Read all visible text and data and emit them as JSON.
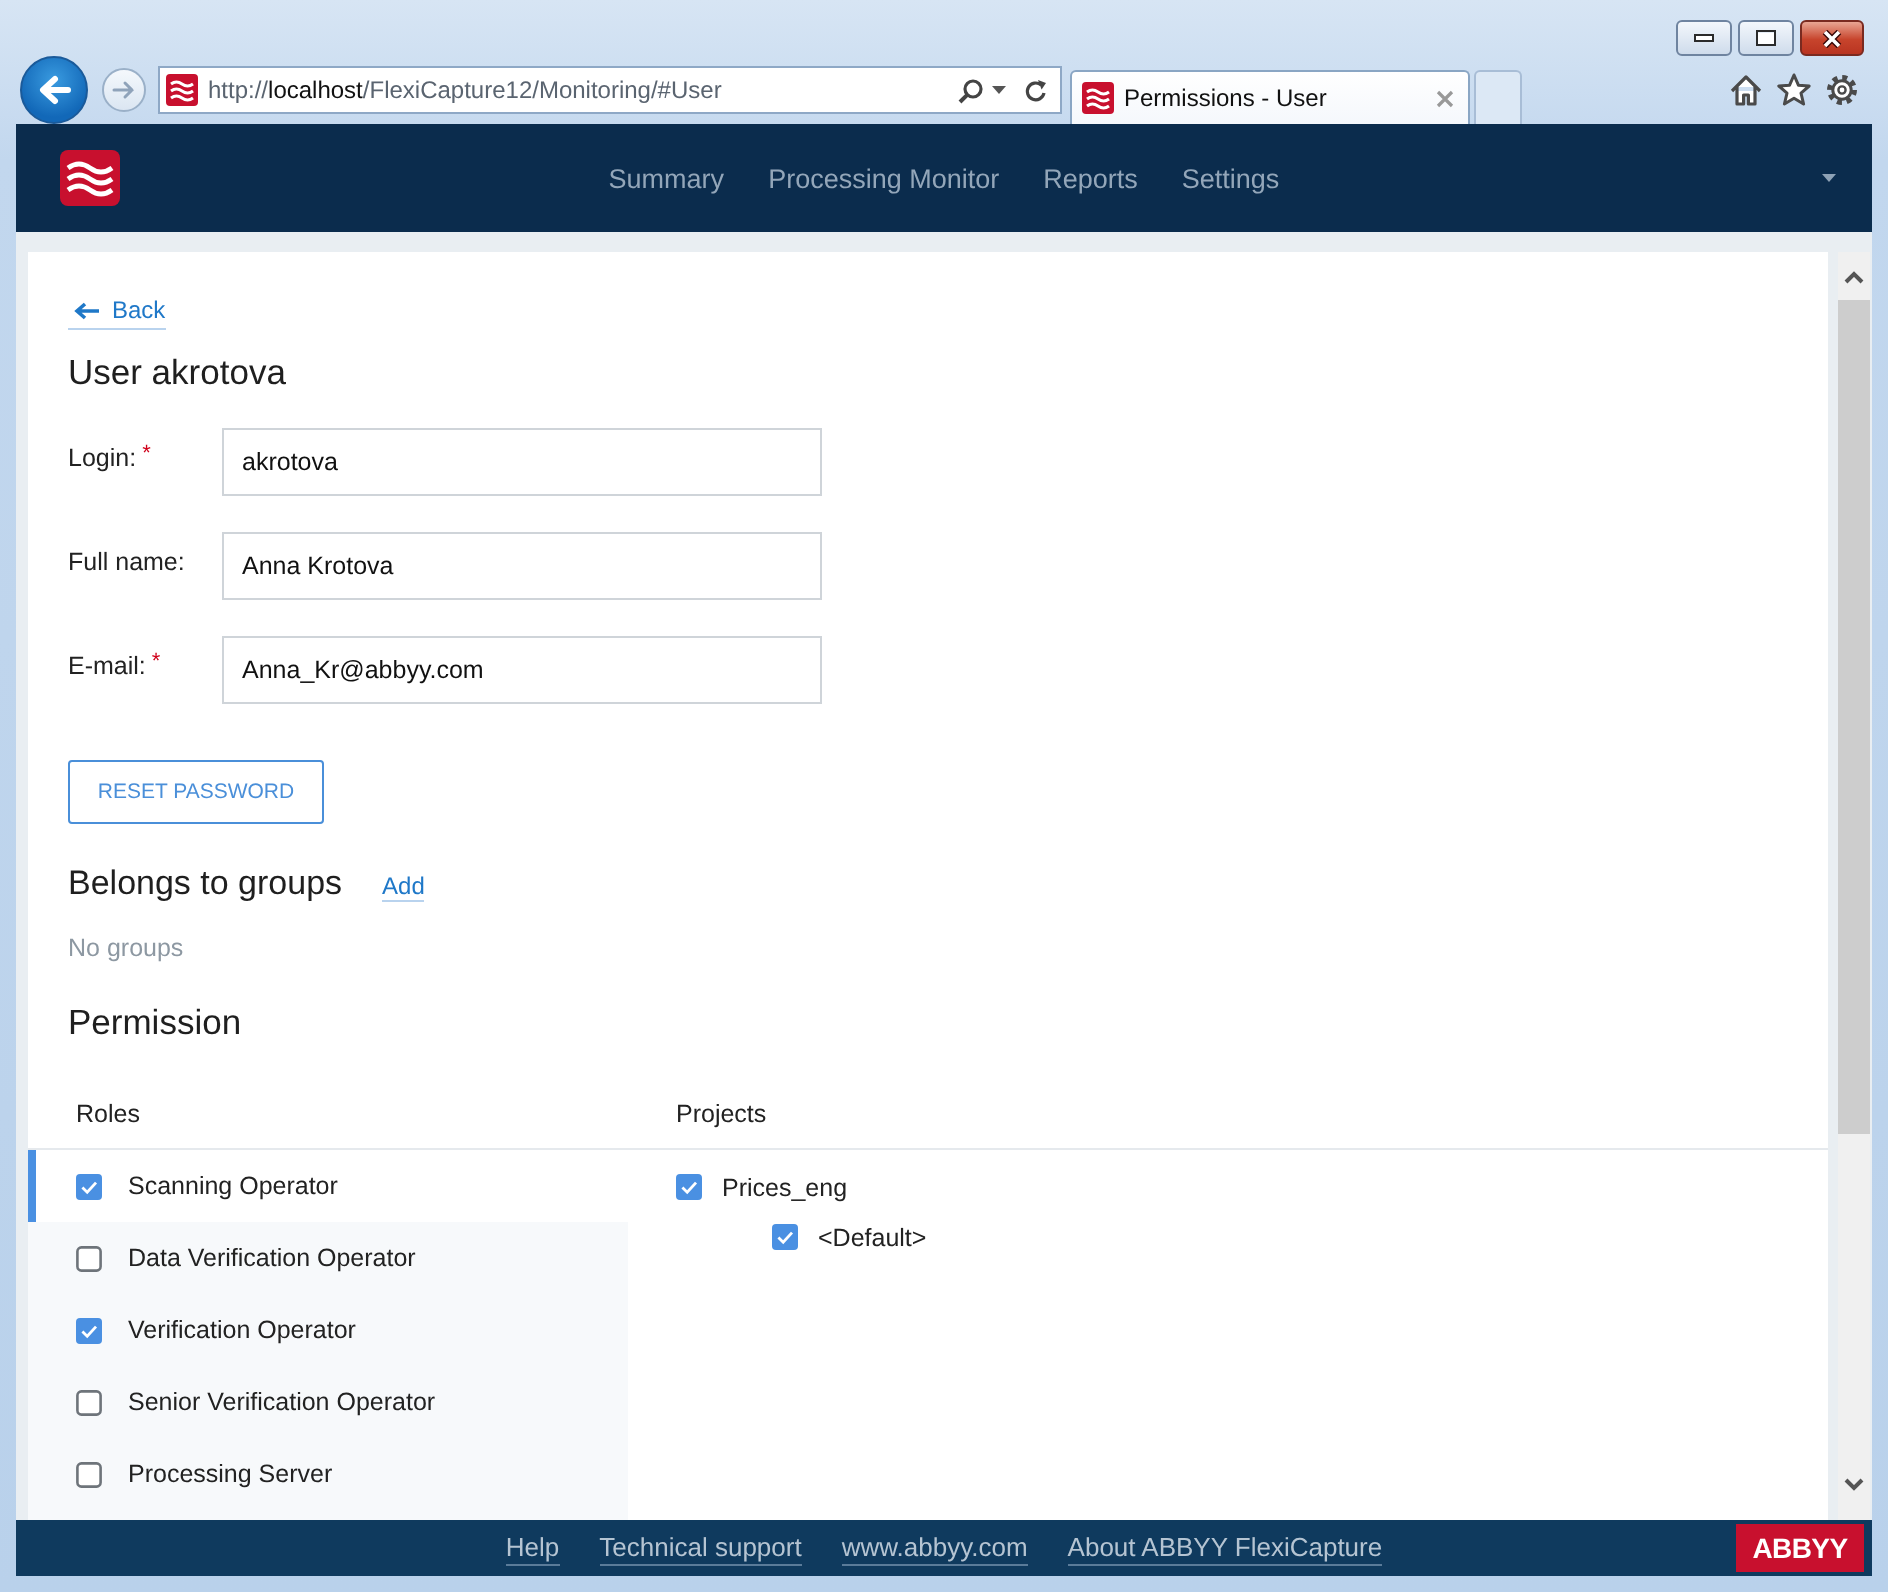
{
  "browser": {
    "url": {
      "scheme": "http://",
      "host": "localhost",
      "path": "/FlexiCapture12/Monitoring/#User"
    },
    "tabs": [
      {
        "title": "Permissions - User",
        "selected": true
      }
    ]
  },
  "navbar": {
    "items": [
      {
        "label": "Summary",
        "selected": false
      },
      {
        "label": "Processing Monitor",
        "selected": false
      },
      {
        "label": "Reports",
        "selected": false
      },
      {
        "label": "Settings",
        "selected": false
      }
    ]
  },
  "page": {
    "back": "Back",
    "title": "User akrotova",
    "fields": [
      {
        "label": "Login:",
        "required_mark": "*",
        "value": "akrotova"
      },
      {
        "label": "Full name:",
        "value": "Anna Krotova"
      },
      {
        "label": "E-mail:",
        "required_mark": "*",
        "value": "Anna_Kr@abbyy.com"
      }
    ],
    "reset_button": "RESET PASSWORD",
    "groups": {
      "title": "Belongs to groups",
      "add_link": "Add",
      "empty_text": "No groups"
    },
    "permission": {
      "title": "Permission",
      "columns": [
        "Roles",
        "Projects"
      ],
      "roles": [
        {
          "label": "Scanning Operator",
          "checked": true,
          "selected": true
        },
        {
          "label": "Data Verification Operator",
          "checked": false,
          "selected": false
        },
        {
          "label": "Verification Operator",
          "checked": true,
          "selected": false
        },
        {
          "label": "Senior Verification Operator",
          "checked": false,
          "selected": false
        },
        {
          "label": "Processing Server",
          "checked": false,
          "selected": false
        }
      ],
      "projects": [
        {
          "label": "Prices_eng",
          "checked": true,
          "children": [
            {
              "label": "<Default>",
              "checked": true
            }
          ]
        }
      ]
    }
  },
  "footer": {
    "links": [
      "Help",
      "Technical support",
      "www.abbyy.com",
      "About ABBYY FlexiCapture"
    ],
    "logo": "ABBYY"
  }
}
